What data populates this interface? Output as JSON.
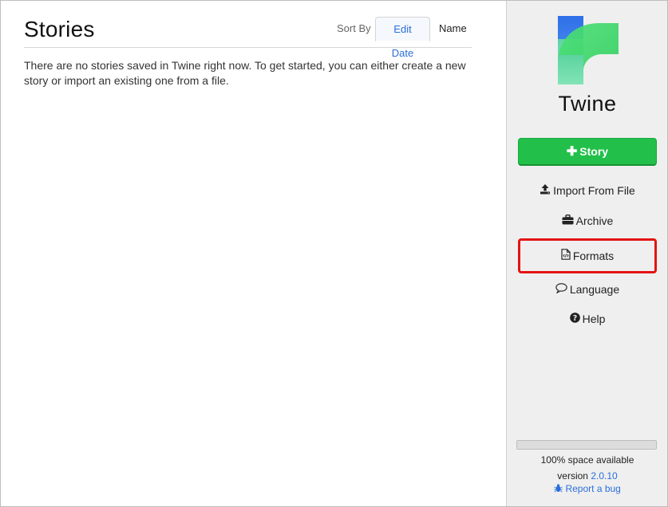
{
  "main": {
    "title": "Stories",
    "sort": {
      "label": "Sort By",
      "options": [
        "Edit Date",
        "Name"
      ],
      "active": "Edit Date"
    },
    "empty_message": "There are no stories saved in Twine right now. To get started, you can either create a new story or import an existing one from a file."
  },
  "sidebar": {
    "brand": "Twine",
    "new_story": {
      "label": "Story",
      "icon": "plus-icon"
    },
    "items": [
      {
        "label": "Import From File",
        "icon": "upload-icon"
      },
      {
        "label": "Archive",
        "icon": "briefcase-icon"
      },
      {
        "label": "Formats",
        "icon": "code-file-icon",
        "highlighted": true
      },
      {
        "label": "Language",
        "icon": "speech-bubble-icon"
      },
      {
        "label": "Help",
        "icon": "question-circle-icon"
      }
    ],
    "storage": {
      "text": "100% space available",
      "fraction_available": 1.0
    },
    "version": {
      "prefix": "version",
      "number": "2.0.10"
    },
    "report_bug": {
      "label": "Report a bug",
      "icon": "bug-icon"
    }
  },
  "colors": {
    "accent_blue": "#2a6fdb",
    "create_green": "#22c04a",
    "highlight_red": "#e41313",
    "sidebar_bg": "#efefef"
  }
}
